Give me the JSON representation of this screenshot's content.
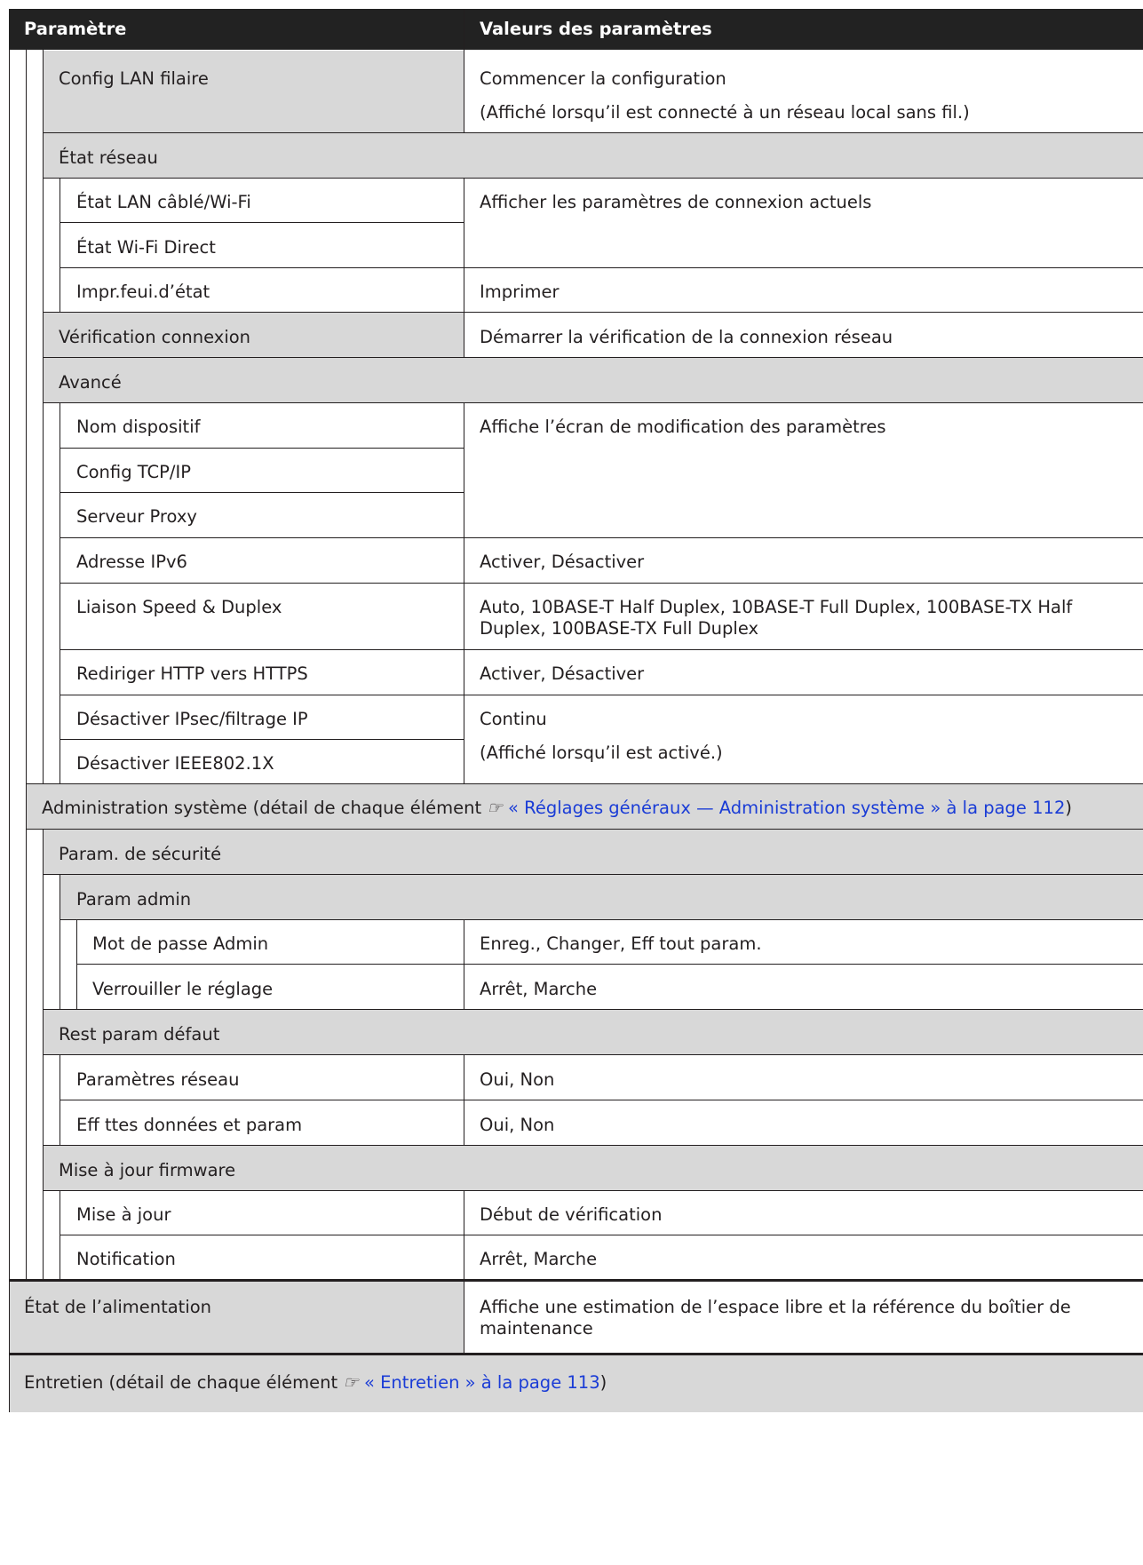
{
  "header": {
    "col_param": "Paramètre",
    "col_values": "Valeurs des paramètres"
  },
  "rows": {
    "config_lan": "Config LAN filaire",
    "config_lan_val1": "Commencer la configuration",
    "config_lan_val2": "(Affiché lorsqu’il est connecté à un réseau local sans fil.)",
    "etat_reseau": "État réseau",
    "etat_lan": "État LAN câblé/Wi-Fi",
    "etat_lan_val": "Afficher les paramètres de connexion actuels",
    "etat_wifi_direct": "État Wi-Fi Direct",
    "impr_feuil": "Impr.feui.d’état",
    "impr_feuil_val": "Imprimer",
    "verif_connexion": "Vérification connexion",
    "verif_connexion_val": "Démarrer la vérification de la connexion réseau",
    "avance": "Avancé",
    "nom_dispositif": "Nom dispositif",
    "nom_dispositif_val": "Affiche l’écran de modification des paramètres",
    "config_tcpip": "Config TCP/IP",
    "serveur_proxy": "Serveur Proxy",
    "adresse_ipv6": "Adresse IPv6",
    "adresse_ipv6_val": "Activer, Désactiver",
    "liaison_speed": "Liaison Speed & Duplex",
    "liaison_speed_val": "Auto, 10BASE-T Half Duplex, 10BASE-T Full Duplex, 100BASE-TX Half Duplex, 100BASE-TX Full Duplex",
    "rediriger_http": "Rediriger HTTP vers HTTPS",
    "rediriger_http_val": "Activer, Désactiver",
    "desact_ipsec": "Désactiver IPsec/filtrage IP",
    "desact_ipsec_val1": "Continu",
    "desact_ipsec_val2": "(Affiché lorsqu’il est activé.)",
    "desact_ieee": "Désactiver IEEE802.1X",
    "admin_sys_prefix": "Administration système (détail de chaque élément ",
    "admin_sys_link": "« Réglages généraux — Administration système » à la page 112",
    "admin_sys_suffix": ")",
    "param_securite": "Param. de sécurité",
    "param_admin": "Param admin",
    "mot_de_passe": "Mot de passe Admin",
    "mot_de_passe_val": "Enreg., Changer, Eff tout param.",
    "verrouiller": "Verrouiller le réglage",
    "verrouiller_val": "Arrêt, Marche",
    "rest_param": "Rest param défaut",
    "param_reseau": "Paramètres réseau",
    "param_reseau_val": "Oui, Non",
    "eff_ttes": "Eff ttes données et param",
    "eff_ttes_val": "Oui, Non",
    "maj_firmware": "Mise à jour firmware",
    "maj": "Mise à jour",
    "maj_val": "Début de vérification",
    "notification": "Notification",
    "notification_val": "Arrêt, Marche",
    "etat_alim": "État de l’alimentation",
    "etat_alim_val": "Affiche une estimation de l’espace libre et la référence du boîtier de maintenance",
    "entretien_prefix": "Entretien (détail de chaque élément ",
    "entretien_link": "« Entretien » à la page 113",
    "entretien_suffix": ")"
  },
  "icons": {
    "reference": "pointing-hand-icon"
  },
  "colors": {
    "header_bg": "#222222",
    "section_bg": "#d8d8d8",
    "link": "#1a3cd6"
  }
}
